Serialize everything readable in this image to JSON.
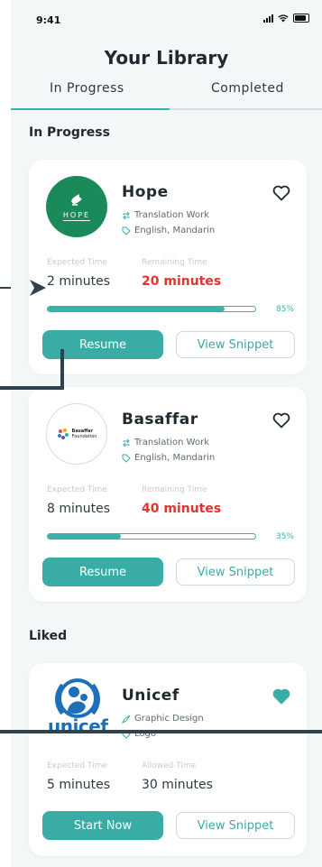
{
  "status": {
    "time": "9:41"
  },
  "page": {
    "title": "Your Library"
  },
  "tabs": [
    {
      "label": "In Progress"
    },
    {
      "label": "Completed"
    }
  ],
  "sections": {
    "in_progress": "In Progress",
    "liked": "Liked"
  },
  "cards": [
    {
      "title": "Hope",
      "logo_text": "HOPE",
      "logo_icon": "dove-hand-icon",
      "type": "Translation Work",
      "languages": "English, Mandarin",
      "label1": "Expected Time",
      "value1": "2 minutes",
      "label2": "Remaining Time",
      "value2": "20 minutes",
      "progress": 85,
      "progress_label": "85%",
      "primary_button": "Resume",
      "secondary_button": "View Snippet",
      "liked": false
    },
    {
      "title": "Basaffar",
      "logo_text": "Basaffar",
      "logo_text2": "Foundation",
      "type": "Translation Work",
      "languages": "English, Mandarin",
      "label1": "Expected Time",
      "value1": "8 minutes",
      "label2": "Remaining Time",
      "value2": "40 minutes",
      "progress": 35,
      "progress_label": "35%",
      "primary_button": "Resume",
      "secondary_button": "View Snippet",
      "liked": false
    },
    {
      "title": "Unicef",
      "logo_text": "unicef",
      "type": "Graphic Design",
      "languages": "Logo",
      "label1": "Expected Time",
      "value1": "5 minutes",
      "label2": "Allowed Time",
      "value2": "30 minutes",
      "primary_button": "Start Now",
      "secondary_button": "View Snippet",
      "liked": true
    }
  ],
  "colors": {
    "accent": "#3aaca6",
    "alert": "#e3322f",
    "hope_green": "#1a8a5a",
    "unicef_blue": "#1c6fb8"
  }
}
